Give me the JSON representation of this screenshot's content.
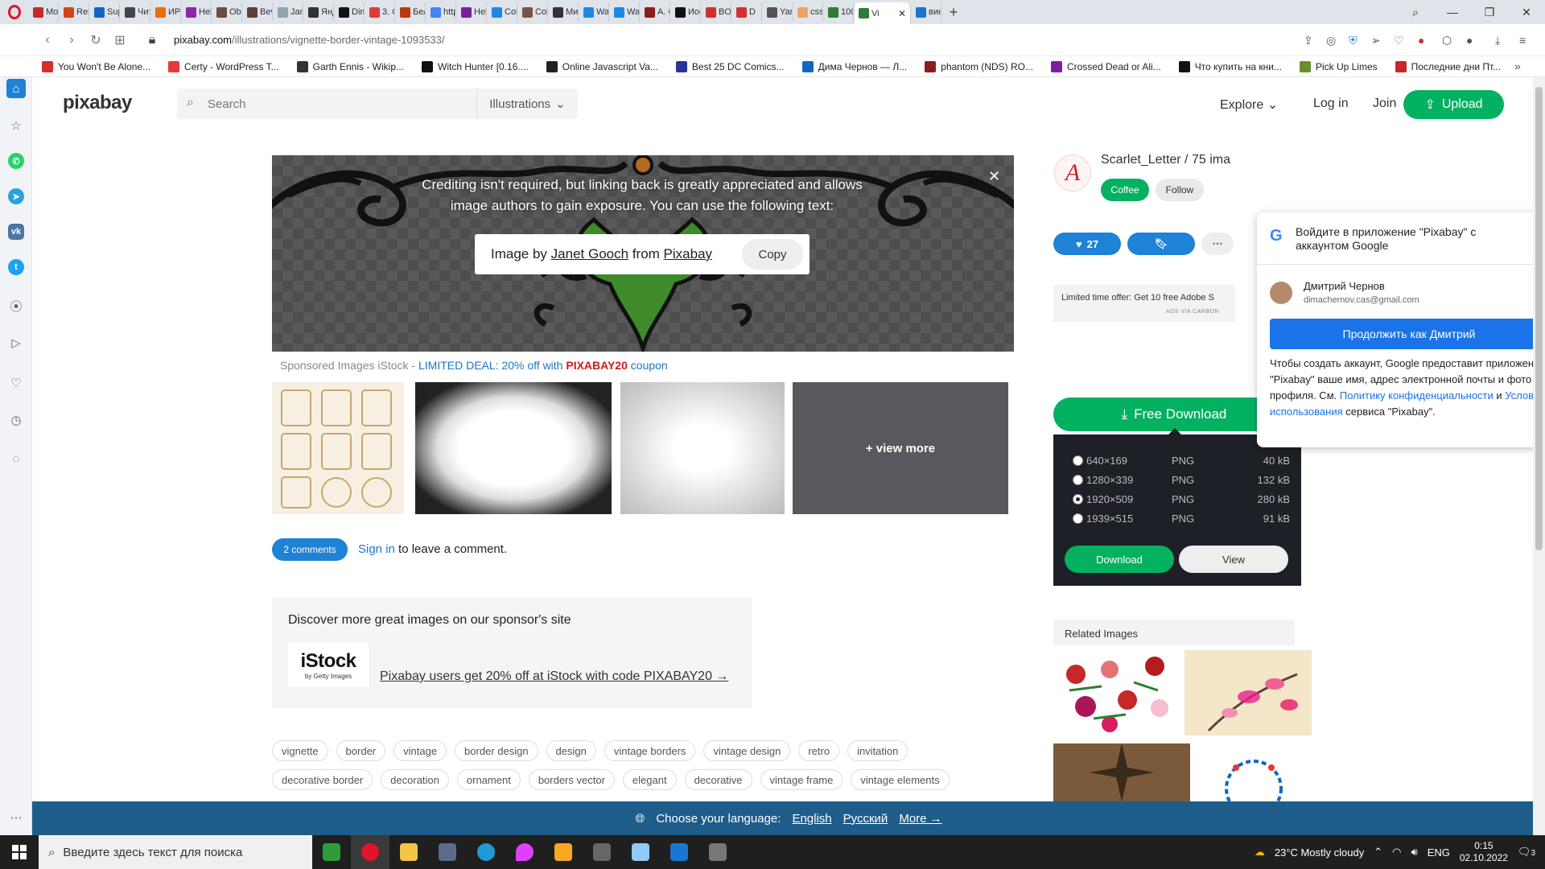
{
  "browser": {
    "tabs": [
      {
        "label": "Mo",
        "color": "#c62828"
      },
      {
        "label": "Rest",
        "color": "#d84315"
      },
      {
        "label": "Sup",
        "color": "#1565c0"
      },
      {
        "label": "Чит",
        "color": "#444"
      },
      {
        "label": "ИРИ",
        "color": "#ef6c00"
      },
      {
        "label": "Heb",
        "color": "#8e24aa"
      },
      {
        "label": "Obl",
        "color": "#6d4c41"
      },
      {
        "label": "Bevi",
        "color": "#5d4037"
      },
      {
        "label": "Jani",
        "color": "#90a4ae"
      },
      {
        "label": "Янд",
        "color": "#333"
      },
      {
        "label": "Dim",
        "color": "#111"
      },
      {
        "label": "3. C",
        "color": "#e53935"
      },
      {
        "label": "Бел",
        "color": "#bf360c"
      },
      {
        "label": "http",
        "color": "#4285f4"
      },
      {
        "label": "Heb",
        "color": "#7b1fa2"
      },
      {
        "label": "Colc",
        "color": "#1e88e5"
      },
      {
        "label": "Colc",
        "color": "#795548"
      },
      {
        "label": "Ми",
        "color": "#333"
      },
      {
        "label": "Wat",
        "color": "#1e88e5"
      },
      {
        "label": "Wat",
        "color": "#1e88e5"
      },
      {
        "label": "A. C",
        "color": "#8d1c1c"
      },
      {
        "label": "Иос",
        "color": "#111"
      },
      {
        "label": "BOR",
        "color": "#d32f2f"
      },
      {
        "label": "D",
        "color": "#d32f2f"
      },
      {
        "label": "Yan",
        "color": "#555"
      },
      {
        "label": "css",
        "color": "#f4a261"
      },
      {
        "label": "100",
        "color": "#2e7d32"
      },
      {
        "label": "Vi",
        "color": "#2e7d32",
        "active": true
      },
      {
        "label": "вин",
        "color": "#1976d2"
      }
    ],
    "url_host": "pixabay.com",
    "url_path": "/illustrations/vignette-border-vintage-1093533/",
    "bookmarks": [
      {
        "label": "You Won't Be Alone...",
        "color": "#d32f2f"
      },
      {
        "label": "Certy - WordPress T...",
        "color": "#e53935"
      },
      {
        "label": "Garth Ennis - Wikip...",
        "color": "#333"
      },
      {
        "label": "Witch Hunter [0.16....",
        "color": "#111"
      },
      {
        "label": "Online Javascript Va...",
        "color": "#222"
      },
      {
        "label": "Best 25 DC Comics...",
        "color": "#283593"
      },
      {
        "label": "Дима Чернов — Л...",
        "color": "#1565c0"
      },
      {
        "label": "phantom (NDS) RO...",
        "color": "#8d1c1c"
      },
      {
        "label": "Crossed Dead or Ali...",
        "color": "#7b1fa2"
      },
      {
        "label": "Что купить на кни...",
        "color": "#111"
      },
      {
        "label": "Pick Up Limes",
        "color": "#6a8d2f"
      },
      {
        "label": "Последние дни Пт...",
        "color": "#c62828"
      }
    ]
  },
  "header": {
    "logo": "pixabay",
    "search_placeholder": "Search",
    "search_type": "Illustrations",
    "explore": "Explore",
    "login": "Log in",
    "join": "Join",
    "upload": "Upload"
  },
  "credit": {
    "text": "Crediting isn't required, but linking back is greatly appreciated and allows image authors to gain exposure. You can use the following text:",
    "prefix": "Image by",
    "author": "Janet Gooch",
    "middle": "from",
    "site": "Pixabay",
    "copy": "Copy"
  },
  "sponsored": {
    "label": "Sponsored Images iStock - ",
    "deal": "LIMITED DEAL: 20% off with ",
    "code": "PIXABAY20",
    "coupon": " coupon",
    "view_more": "+ view more"
  },
  "comments": {
    "button": "2 comments",
    "signin": "Sign in",
    "rest": " to leave a comment."
  },
  "sponsor_box": {
    "title": "Discover more great images on our sponsor's site",
    "logo": "iStock",
    "logo_sub": "by Getty Images",
    "link": "Pixabay users get 20% off at iStock with code PIXABAY20 →"
  },
  "tags": [
    "vignette",
    "border",
    "vintage",
    "border design",
    "design",
    "vintage borders",
    "vintage design",
    "retro",
    "invitation",
    "decorative border",
    "decoration",
    "ornament",
    "borders vector",
    "elegant",
    "decorative",
    "vintage frame",
    "vintage elements"
  ],
  "author": {
    "name": "Scarlet_Letter / 75 ima",
    "initial": "A",
    "coffee": "Coffee",
    "follow": "Follow",
    "likes": "27"
  },
  "ad": {
    "text": "Limited time offer: Get 10 free Adobe S",
    "via": "ADS VIA CARBON"
  },
  "download": {
    "button": "Free Download",
    "options": [
      {
        "res": "640×169",
        "fmt": "PNG",
        "size": "40 kB",
        "selected": false
      },
      {
        "res": "1280×339",
        "fmt": "PNG",
        "size": "132 kB",
        "selected": false
      },
      {
        "res": "1920×509",
        "fmt": "PNG",
        "size": "280 kB",
        "selected": true
      },
      {
        "res": "1939×515",
        "fmt": "PNG",
        "size": "91 kB",
        "selected": false
      }
    ],
    "download": "Download",
    "view": "View"
  },
  "related": {
    "title": "Related Images"
  },
  "google": {
    "title": "Войдите в приложение \"Pixabay\" с аккаунтом Google",
    "name": "Дмитрий Чернов",
    "email": "dimachernov.cas@gmail.com",
    "continue": "Продолжить как Дмитрий",
    "desc_1": "Чтобы создать аккаунт, Google предоставит приложению \"Pixabay\" ваше имя, адрес электронной почты и фото профиля. См. ",
    "policy": "Политику конфиденциальности",
    "and": " и ",
    "terms": "Условия использования",
    "desc_2": " сервиса \"Pixabay\"."
  },
  "language": {
    "label": "Choose your language:",
    "english": "English",
    "russian": "Русский",
    "more": "More →"
  },
  "taskbar": {
    "search": "Введите здесь текст для поиска",
    "weather": "23°C  Mostly cloudy",
    "lang": "ENG",
    "time": "0:15",
    "date": "02.10.2022",
    "notifications": "3"
  }
}
